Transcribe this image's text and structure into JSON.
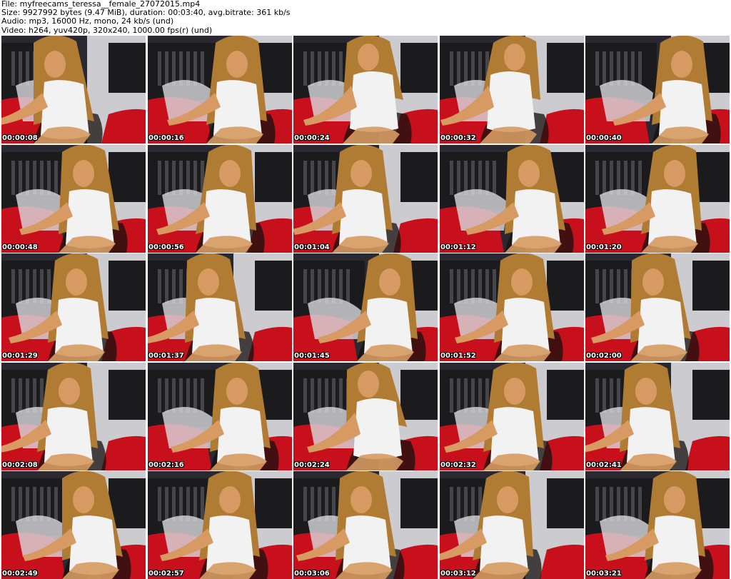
{
  "info": {
    "file": "File: myfreecams_teressa__female_27072015.mp4",
    "size": "Size: 9927992 bytes (9.47 MiB), duration: 00:03:40, avg.bitrate: 361 kb/s",
    "audio": "Audio: mp3, 16000 Hz, mono, 24 kb/s (und)",
    "video": "Video: h264, yuv420p, 320x240, 1000.00 fps(r) (und)"
  },
  "colors": {
    "background": "#ffffff",
    "headboard": "#1b1b1d",
    "bedding_red": "#c8101c",
    "wall": "#e8e8ec",
    "hair": "#b07c34",
    "skin": "#d69a62",
    "shirt": "#f2f2f2",
    "timestamp": "#ffffff"
  },
  "thumbnails": [
    {
      "time": "00:00:08"
    },
    {
      "time": "00:00:16"
    },
    {
      "time": "00:00:24"
    },
    {
      "time": "00:00:32"
    },
    {
      "time": "00:00:40"
    },
    {
      "time": "00:00:48"
    },
    {
      "time": "00:00:56"
    },
    {
      "time": "00:01:04"
    },
    {
      "time": "00:01:12"
    },
    {
      "time": "00:01:20"
    },
    {
      "time": "00:01:29"
    },
    {
      "time": "00:01:37"
    },
    {
      "time": "00:01:45"
    },
    {
      "time": "00:01:52"
    },
    {
      "time": "00:02:00"
    },
    {
      "time": "00:02:08"
    },
    {
      "time": "00:02:16"
    },
    {
      "time": "00:02:24"
    },
    {
      "time": "00:02:32"
    },
    {
      "time": "00:02:41"
    },
    {
      "time": "00:02:49"
    },
    {
      "time": "00:02:57"
    },
    {
      "time": "00:03:06"
    },
    {
      "time": "00:03:12"
    },
    {
      "time": "00:03:21"
    }
  ]
}
